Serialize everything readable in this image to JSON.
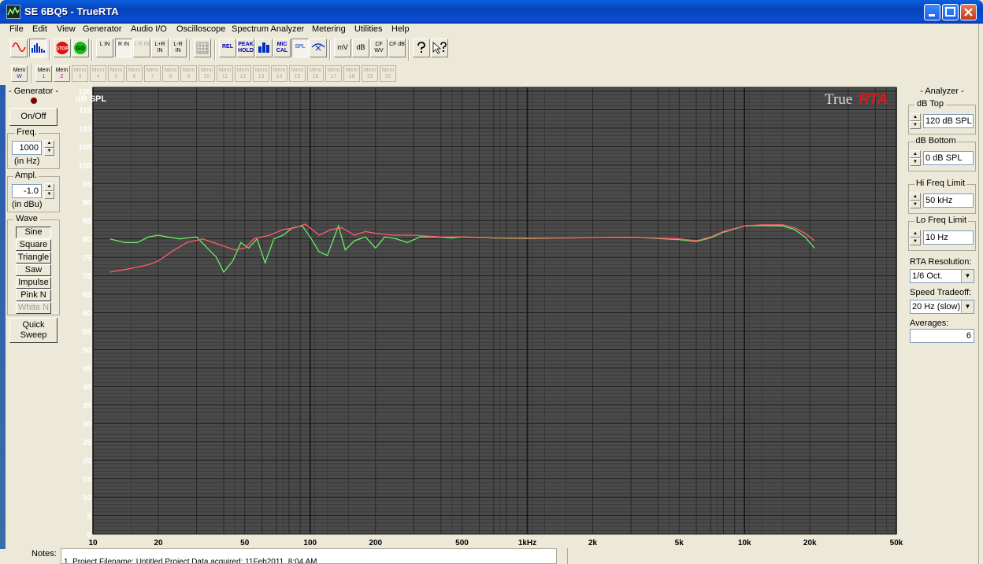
{
  "window": {
    "title": "SE 6BQ5 - TrueRTA"
  },
  "menu": [
    "File",
    "Edit",
    "View",
    "Generator",
    "Audio I/O",
    "Oscilloscope",
    "Spectrum Analyzer",
    "Metering",
    "Utilities",
    "Help"
  ],
  "toolbar": {
    "stop": "STOP",
    "go": "GO",
    "l_in": "L IN",
    "r_in": "R IN",
    "lr_in": "L R IN",
    "lplusr_in": "L+R IN",
    "lminusr_in": "L-R IN",
    "rel": "REL",
    "peak_hold": "PEAK HOLD",
    "mic_cal": "MIC CAL",
    "spl": "SPL",
    "mv": "mV",
    "db": "dB",
    "cf_wv": "CF WV",
    "cf_db": "CF dB"
  },
  "memory": {
    "prefix": "Mem",
    "w_label": "W",
    "slots": [
      "1",
      "2",
      "3",
      "4",
      "5",
      "6",
      "7",
      "8",
      "9",
      "10",
      "11",
      "12",
      "13",
      "14",
      "15",
      "16",
      "17",
      "18",
      "19",
      "20"
    ]
  },
  "generator": {
    "title": "- Generator -",
    "on_off": "On/Off",
    "freq_label": "Freq.",
    "freq_value": "1000",
    "freq_unit": "(in Hz)",
    "ampl_label": "Ampl.",
    "ampl_value": "-1.0",
    "ampl_unit": "(in dBu)",
    "wave_label": "Wave",
    "waves": [
      "Sine",
      "Square",
      "Triangle",
      "Saw",
      "Impulse",
      "Pink N",
      "White N"
    ],
    "selected_wave": "Sine",
    "quick_sweep": "Quick Sweep"
  },
  "analyzer": {
    "title": "- Analyzer -",
    "db_top_label": "dB Top",
    "db_top_value": "120 dB SPL",
    "db_bottom_label": "dB Bottom",
    "db_bottom_value": "0 dB SPL",
    "hi_freq_label": "Hi Freq Limit",
    "hi_freq_value": "50 kHz",
    "lo_freq_label": "Lo Freq Limit",
    "lo_freq_value": "10 Hz",
    "rta_res_label": "RTA Resolution:",
    "rta_res_value": "1/6 Oct.",
    "speed_label": "Speed Tradeoff:",
    "speed_value": "20 Hz (slow)",
    "averages_label": "Averages:",
    "averages_value": "6"
  },
  "notes": {
    "label": "Notes:",
    "text": "1. Project Filename: Untitled Project      Data acquired: 11Feb2011, 8:04 AM"
  },
  "chart_data": {
    "type": "line",
    "logo_left": "True",
    "logo_right": "RTA",
    "ylabel": "dB SPL",
    "ylim": [
      0,
      120
    ],
    "yticks": [
      0,
      5,
      10,
      15,
      20,
      25,
      30,
      35,
      40,
      45,
      50,
      55,
      60,
      65,
      70,
      75,
      80,
      85,
      90,
      95,
      100,
      105,
      110,
      115,
      120
    ],
    "xlim": [
      10,
      50000
    ],
    "xscale": "log",
    "xticks": [
      {
        "v": 10,
        "label": "10"
      },
      {
        "v": 20,
        "label": "20"
      },
      {
        "v": 50,
        "label": "50"
      },
      {
        "v": 100,
        "label": "100"
      },
      {
        "v": 200,
        "label": "200"
      },
      {
        "v": 500,
        "label": "500"
      },
      {
        "v": 1000,
        "label": "1kHz"
      },
      {
        "v": 2000,
        "label": "2k"
      },
      {
        "v": 5000,
        "label": "5k"
      },
      {
        "v": 10000,
        "label": "10k"
      },
      {
        "v": 20000,
        "label": "20k"
      },
      {
        "v": 50000,
        "label": "50k"
      }
    ],
    "series": [
      {
        "color": "#ff5a6a",
        "x": [
          12,
          15,
          18,
          20,
          23,
          27,
          32,
          38,
          45,
          50,
          55,
          65,
          75,
          85,
          95,
          110,
          125,
          140,
          160,
          180,
          200,
          240,
          300,
          400,
          500,
          700,
          1000,
          2000,
          3000,
          4000,
          5000,
          6000,
          7000,
          8000,
          10000,
          12000,
          15000,
          17000,
          19000,
          21000
        ],
        "y": [
          71,
          72,
          73,
          74,
          76.5,
          79,
          80,
          78.5,
          77,
          77.5,
          80,
          81,
          82.5,
          83,
          84,
          81,
          82.5,
          83,
          81,
          82,
          81.5,
          81,
          81,
          80.5,
          80.5,
          80.3,
          80.2,
          80.3,
          80.4,
          80.2,
          80,
          79.5,
          80.5,
          82,
          83.5,
          83.8,
          83.8,
          83,
          81.5,
          79.5
        ]
      },
      {
        "color": "#66ee66",
        "x": [
          12,
          14,
          16,
          18,
          20,
          22,
          25,
          30,
          33,
          37,
          40,
          44,
          48,
          52,
          57,
          62,
          68,
          75,
          83,
          92,
          100,
          110,
          120,
          135,
          145,
          160,
          180,
          200,
          220,
          250,
          280,
          320,
          380,
          450,
          500,
          700,
          1000,
          2000,
          3000,
          4000,
          5000,
          6000,
          7000,
          8000,
          10000,
          12000,
          15000,
          17000,
          19000,
          21000
        ],
        "y": [
          80,
          79,
          79,
          80.5,
          81,
          80.5,
          80,
          80.5,
          78,
          75,
          71,
          74,
          79,
          77.5,
          80,
          73.5,
          80,
          81,
          83,
          83.5,
          80.5,
          76.5,
          75.5,
          83.5,
          77,
          79.5,
          80.5,
          77.5,
          80.5,
          80,
          79,
          80.5,
          80.5,
          80.2,
          80.5,
          80.2,
          80.1,
          80.3,
          80.4,
          80.1,
          79.8,
          79.3,
          80.3,
          81.8,
          83.5,
          83.6,
          83.5,
          82.5,
          80.5,
          77.5
        ]
      }
    ]
  }
}
